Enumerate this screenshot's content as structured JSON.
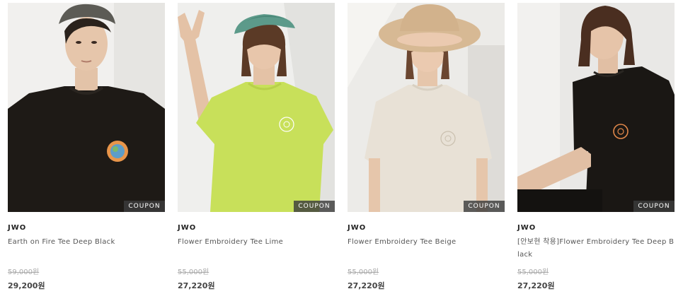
{
  "products": [
    {
      "brand": "JWO",
      "name": "Earth on Fire Tee Deep Black",
      "original_price": "59,000원",
      "sale_price": "29,200원",
      "coupon_label": "COUPON",
      "shirt_color": "#1e1a16",
      "background_color": "#f1f0ee"
    },
    {
      "brand": "JWO",
      "name": "Flower Embroidery Tee Lime",
      "original_price": "55,000원",
      "sale_price": "27,220원",
      "coupon_label": "COUPON",
      "shirt_color": "#c8e05a",
      "background_color": "#efefed"
    },
    {
      "brand": "JWO",
      "name": "Flower Embroidery Tee Beige",
      "original_price": "55,000원",
      "sale_price": "27,220원",
      "coupon_label": "COUPON",
      "shirt_color": "#e8e1d6",
      "background_color": "#ecebe8"
    },
    {
      "brand": "JWO",
      "name": "[안보현 착용]Flower Embroidery Tee Deep Black",
      "original_price": "55,000원",
      "sale_price": "27,220원",
      "coupon_label": "COUPON",
      "shirt_color": "#1a1714",
      "background_color": "#e9e8e6"
    }
  ]
}
